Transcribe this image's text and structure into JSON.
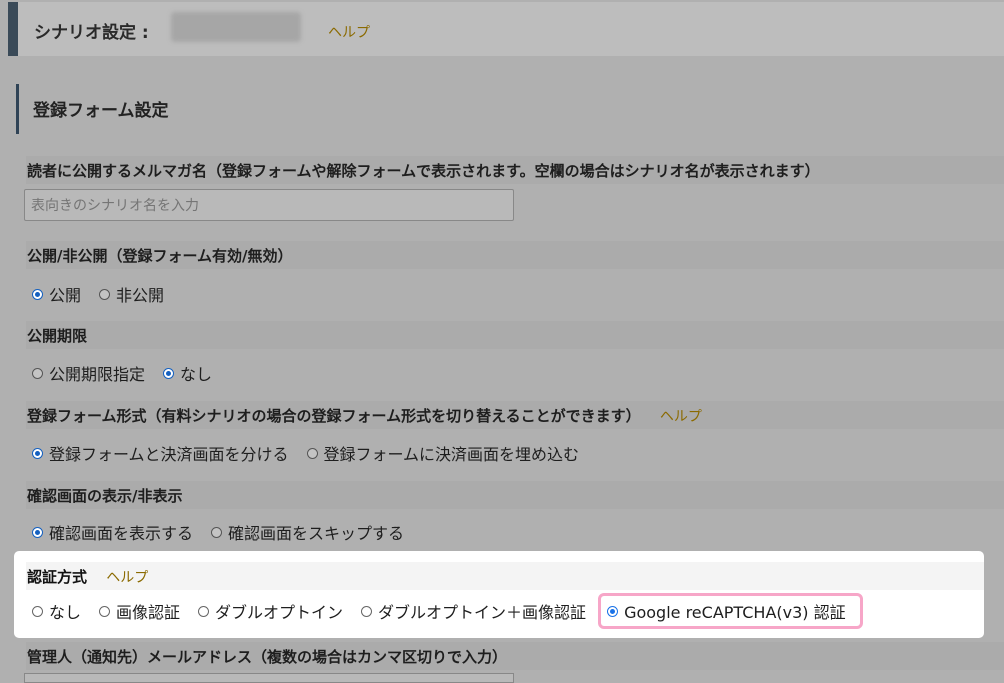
{
  "header": {
    "title": "シナリオ設定 :",
    "help": "ヘルプ"
  },
  "section_title": "登録フォーム設定",
  "public_name": {
    "label": "読者に公開するメルマガ名（登録フォームや解除フォームで表示されます。空欄の場合はシナリオ名が表示されます）",
    "placeholder": "表向きのシナリオ名を入力",
    "value": ""
  },
  "publish": {
    "label": "公開/非公開（登録フォーム有効/無効）",
    "options": [
      {
        "label": "公開",
        "checked": true
      },
      {
        "label": "非公開",
        "checked": false
      }
    ]
  },
  "period": {
    "label": "公開期限",
    "options": [
      {
        "label": "公開期限指定",
        "checked": false
      },
      {
        "label": "なし",
        "checked": true
      }
    ]
  },
  "form_type": {
    "label": "登録フォーム形式（有料シナリオの場合の登録フォーム形式を切り替えることができます）",
    "help": "ヘルプ",
    "options": [
      {
        "label": "登録フォームと決済画面を分ける",
        "checked": true
      },
      {
        "label": "登録フォームに決済画面を埋め込む",
        "checked": false
      }
    ]
  },
  "confirm": {
    "label": "確認画面の表示/非表示",
    "options": [
      {
        "label": "確認画面を表示する",
        "checked": true
      },
      {
        "label": "確認画面をスキップする",
        "checked": false
      }
    ]
  },
  "auth": {
    "label": "認証方式",
    "help": "ヘルプ",
    "options": [
      {
        "label": "なし",
        "checked": false
      },
      {
        "label": "画像認証",
        "checked": false
      },
      {
        "label": "ダブルオプトイン",
        "checked": false
      },
      {
        "label": "ダブルオプトイン＋画像認証",
        "checked": false
      },
      {
        "label": "Google reCAPTCHA(v3) 認証",
        "checked": true
      }
    ],
    "highlight_color": "#f7a6c8"
  },
  "admin_email": {
    "label": "管理人（通知先）メールアドレス（複数の場合はカンマ区切りで入力）"
  }
}
